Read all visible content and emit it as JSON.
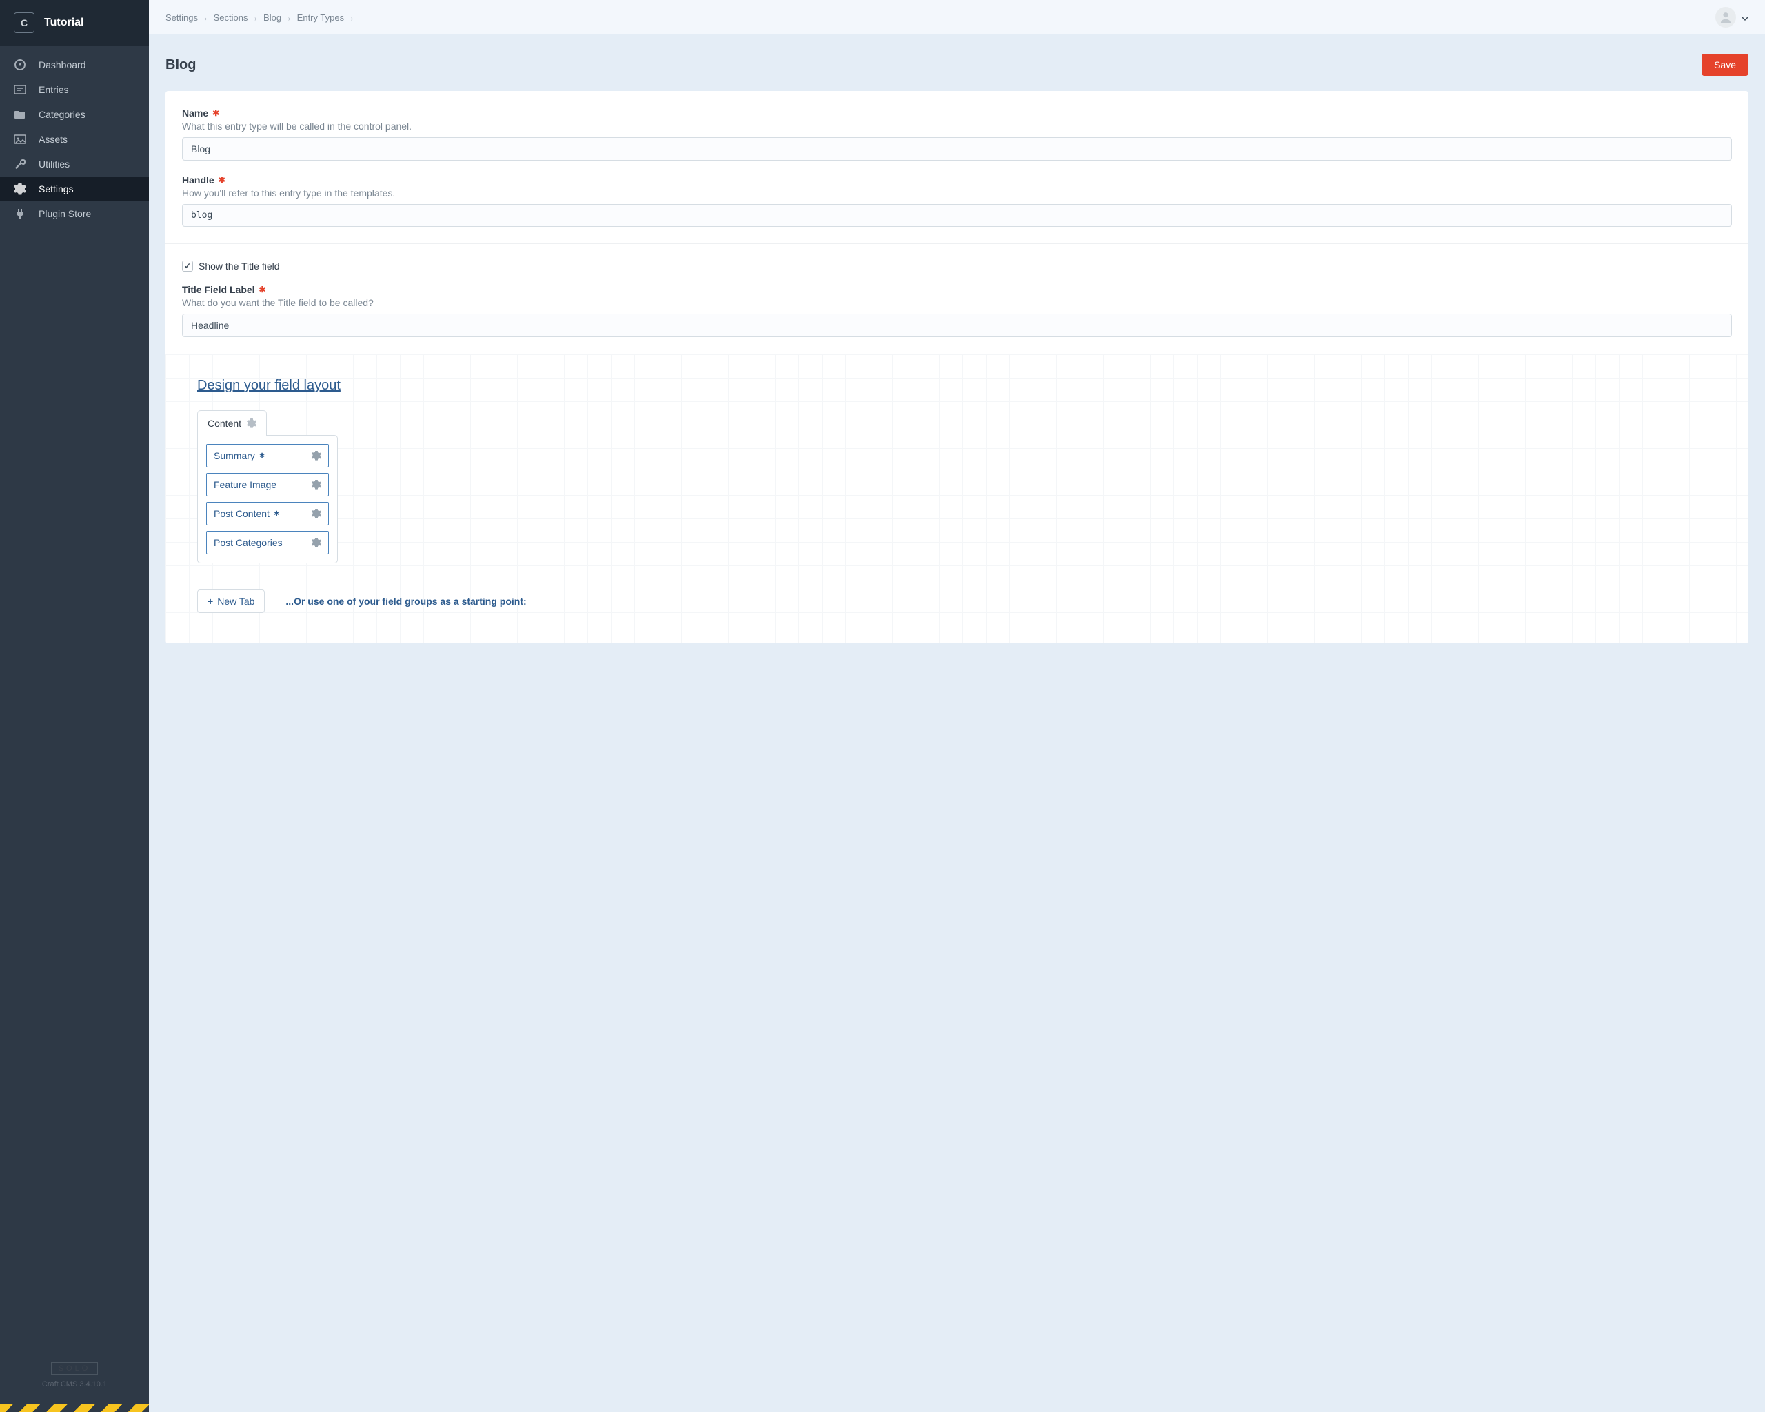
{
  "site": {
    "icon_letter": "C",
    "name": "Tutorial"
  },
  "nav": {
    "items": [
      {
        "key": "dashboard",
        "label": "Dashboard"
      },
      {
        "key": "entries",
        "label": "Entries"
      },
      {
        "key": "categories",
        "label": "Categories"
      },
      {
        "key": "assets",
        "label": "Assets"
      },
      {
        "key": "utilities",
        "label": "Utilities"
      },
      {
        "key": "settings",
        "label": "Settings"
      },
      {
        "key": "plugin-store",
        "label": "Plugin Store"
      }
    ]
  },
  "sidebar_footer": {
    "edition": "SOLO",
    "version": "Craft CMS 3.4.10.1"
  },
  "breadcrumbs": {
    "items": [
      {
        "label": "Settings"
      },
      {
        "label": "Sections"
      },
      {
        "label": "Blog"
      },
      {
        "label": "Entry Types"
      }
    ]
  },
  "page": {
    "title": "Blog",
    "save_label": "Save"
  },
  "fields": {
    "name": {
      "label": "Name",
      "hint": "What this entry type will be called in the control panel.",
      "value": "Blog"
    },
    "handle": {
      "label": "Handle",
      "hint": "How you'll refer to this entry type in the templates.",
      "value": "blog"
    },
    "show_title": {
      "label": "Show the Title field",
      "checked": true
    },
    "title_label": {
      "label": "Title Field Label",
      "hint": "What do you want the Title field to be called?",
      "value": "Headline"
    }
  },
  "fld": {
    "heading": "Design your field layout",
    "tab_label": "Content",
    "items": [
      {
        "label": "Summary",
        "required": true
      },
      {
        "label": "Feature Image",
        "required": false
      },
      {
        "label": "Post Content",
        "required": true
      },
      {
        "label": "Post Categories",
        "required": false
      }
    ],
    "new_tab_label": "New Tab",
    "starting_point_hint": "...Or use one of your field groups as a starting point:"
  }
}
